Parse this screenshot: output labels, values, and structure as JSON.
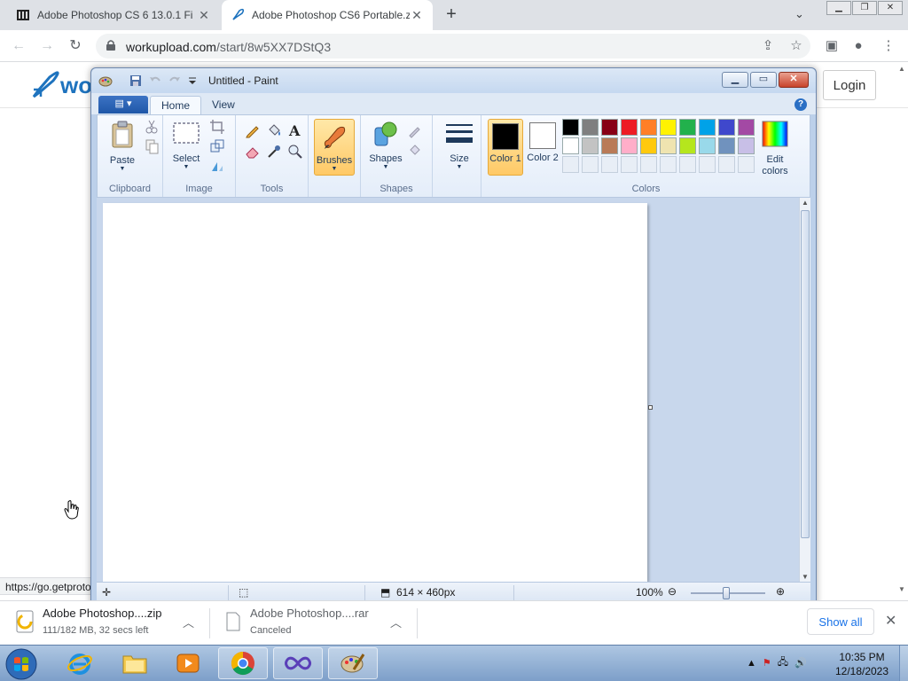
{
  "browser": {
    "tabs": [
      {
        "title": "Adobe Photoshop CS 6 13.0.1 Fi",
        "active": false
      },
      {
        "title": "Adobe Photoshop CS6 Portable.z",
        "active": true
      }
    ],
    "new_tab": "+",
    "url_host": "workupload.com",
    "url_path": "/start/8w5XX7DStQ3",
    "status_url": "https://go.getproto"
  },
  "site": {
    "logo_text": "wo",
    "login_label": "Login"
  },
  "paint": {
    "title": "Untitled - Paint",
    "tabs": [
      "Home",
      "View"
    ],
    "groups": {
      "clipboard": "Clipboard",
      "image": "Image",
      "tools": "Tools",
      "shapes": "Shapes",
      "colors": "Colors"
    },
    "buttons": {
      "paste": "Paste",
      "select": "Select",
      "brushes": "Brushes",
      "shapes": "Shapes",
      "size": "Size",
      "color1": "Color 1",
      "color2": "Color 2",
      "edit_colors": "Edit colors"
    },
    "color1_value": "#000000",
    "color2_value": "#ffffff",
    "palette_row1": [
      "#000000",
      "#7f7f7f",
      "#880015",
      "#ed1c24",
      "#ff7f27",
      "#fff200",
      "#22b14c",
      "#00a2e8",
      "#3f48cc",
      "#a349a4"
    ],
    "palette_row2": [
      "#ffffff",
      "#c3c3c3",
      "#b97a57",
      "#ffaec9",
      "#ffc90e",
      "#efe4b0",
      "#b5e61d",
      "#99d9ea",
      "#7092be",
      "#c8bfe7"
    ],
    "status": {
      "canvas_size": "614 × 460px",
      "zoom": "100%"
    }
  },
  "downloads": [
    {
      "name": "Adobe Photoshop....zip",
      "sub": "111/182 MB, 32 secs left"
    },
    {
      "name": "Adobe Photoshop....rar",
      "sub": "Canceled"
    }
  ],
  "show_all_label": "Show all",
  "taskbar": {
    "time": "10:35 PM",
    "date": "12/18/2023"
  }
}
